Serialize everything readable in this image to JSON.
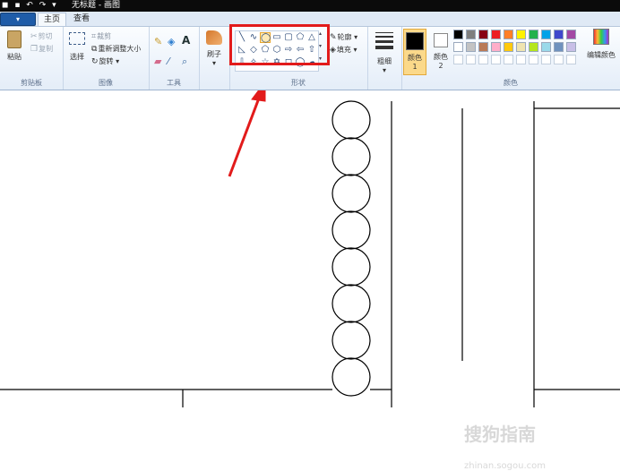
{
  "titlebar": {
    "title": "无标题 - 画图"
  },
  "tabs": {
    "file": "▾",
    "home": "主页",
    "view": "查看"
  },
  "clipboard": {
    "paste": "粘贴",
    "cut": "剪切",
    "copy": "复制",
    "label": "剪贴板"
  },
  "image": {
    "select": "选择",
    "crop": "裁剪",
    "resize": "重新调整大小",
    "rotate": "旋转",
    "label": "图像"
  },
  "tools": {
    "label": "工具",
    "text_icon": "A"
  },
  "brushes": {
    "label": "刷子"
  },
  "shapes_group": {
    "outline": "轮廓",
    "fill": "填充",
    "label": "形状"
  },
  "size": {
    "label": "粗细"
  },
  "colors": {
    "color1": "颜色 1",
    "color2": "颜色 2",
    "edit": "编辑颜色",
    "label": "颜色",
    "row1": [
      "#000000",
      "#7f7f7f",
      "#880015",
      "#ed1c24",
      "#ff7f27",
      "#fff200",
      "#22b14c",
      "#00a2e8",
      "#3f48cc",
      "#a349a4"
    ],
    "row2": [
      "#ffffff",
      "#c3c3c3",
      "#b97a57",
      "#ffaec9",
      "#ffc90e",
      "#efe4b0",
      "#b5e61d",
      "#99d9ea",
      "#7092be",
      "#c8bfe7"
    ],
    "accent_red": "#e21b1b"
  },
  "watermark": {
    "main": "搜狗指南",
    "url": "zhinan.sogou.com"
  }
}
